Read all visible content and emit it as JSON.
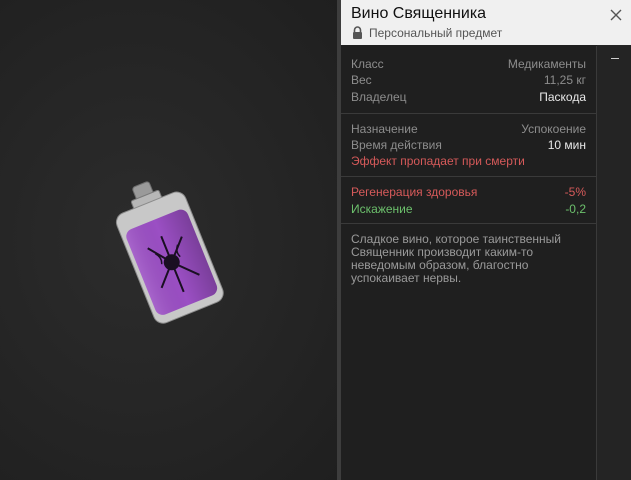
{
  "item": {
    "title": "Вино Священника",
    "subtitle": "Персональный предмет",
    "stats_group1": [
      {
        "key": "Класс",
        "value": "Медикаменты"
      },
      {
        "key": "Вес",
        "value": "11,25 кг"
      },
      {
        "key": "Владелец",
        "value": "Паскода"
      }
    ],
    "stats_group2": [
      {
        "key": "Назначение",
        "value": "Успокоение"
      },
      {
        "key": "Время действия",
        "value": "10 мин"
      }
    ],
    "effect_warning": "Эффект пропадает при смерти",
    "modifiers": [
      {
        "key": "Регенерация здоровья",
        "value": "-5%"
      },
      {
        "key": "Искажение",
        "value": "-0,2"
      }
    ],
    "description": "Сладкое вино, которое таинственный Священник производит каким-то неведомым образом, благостно успокаивает нервы."
  },
  "icons": {
    "lock": "lock-icon",
    "close": "close-icon",
    "flask": "flask-item-image"
  },
  "colors": {
    "negative": "#d65a5a",
    "positive": "#6cc06c",
    "flask_purple": "#9b4fc4"
  }
}
